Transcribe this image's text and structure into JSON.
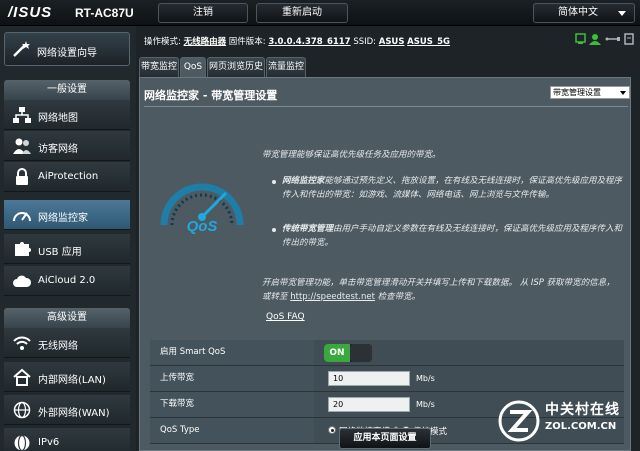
{
  "header": {
    "brand": "/ISUS",
    "model": "RT-AC87U",
    "logout_label": "注销",
    "reboot_label": "重新启动",
    "language": "简体中文"
  },
  "sidebar": {
    "wizard_label": "网络设置向导",
    "general_title": "一般设置",
    "general_items": [
      {
        "label": "网络地图",
        "icon": "network-map-icon"
      },
      {
        "label": "访客网络",
        "icon": "guest-network-icon"
      },
      {
        "label": "AiProtection",
        "icon": "aiprotection-lock-icon"
      },
      {
        "label": "网络监控家",
        "icon": "traffic-gauge-icon"
      },
      {
        "label": "USB 应用",
        "icon": "usb-puzzle-icon"
      },
      {
        "label": "AiCloud 2.0",
        "icon": "cloud-icon"
      }
    ],
    "advanced_title": "高级设置",
    "advanced_items": [
      {
        "label": "无线网络",
        "icon": "wireless-icon"
      },
      {
        "label": "内部网络(LAN)",
        "icon": "home-icon"
      },
      {
        "label": "外部网络(WAN)",
        "icon": "globe-icon"
      },
      {
        "label": "IPv6",
        "icon": "ipv6-globe-icon"
      }
    ]
  },
  "status": {
    "mode_label": "操作模式:",
    "mode_value": "无线路由器",
    "fw_label": "固件版本:",
    "fw_value": "3.0.0.4.378_6117",
    "ssid_label": "SSID:",
    "ssid_1": "ASUS",
    "ssid_2": "ASUS_5G",
    "icons": [
      "client-status-icon",
      "user-status-icon",
      "usb-status-icon",
      "app-status-icon"
    ]
  },
  "tabs": [
    {
      "label": "带宽监控"
    },
    {
      "label": "QoS"
    },
    {
      "label": "网页浏览历史"
    },
    {
      "label": "流量监控"
    }
  ],
  "panel": {
    "title": "网络监控家 - 带宽管理设置",
    "select_value": "带宽管理设置",
    "gauge_text": "QoS",
    "intro": "带宽管理能够保证高优先级任务及应用的带宽。",
    "bullet1_title": "网络监控家",
    "bullet1_body": "能够通过预先定义、拖放设置，在有线及无线连接时，保证高优先级应用及程序传入和传出的带宽：如游戏、流媒体、网络电话、网上浏览与文件传输。",
    "bullet2_title": "传统带宽管理",
    "bullet2_body": "由用户手动自定义参数在有线及无线连接时，保证高优先级应用及程序传入和传出的带宽。",
    "hint_pre": "开启带宽管理功能，单击带宽管理滑动开关并填写上传和下载数据。 从 ISP 获取带宽的信息，或转至",
    "hint_link": "http://speedtest.net",
    "hint_post": "检查带宽。",
    "faq_link": "QoS FAQ"
  },
  "settings": {
    "enable_label": "启用 Smart QoS",
    "toggle_on": "ON",
    "upload_label": "上传带宽",
    "upload_value": "10",
    "upload_unit": "Mb/s",
    "download_label": "下载带宽",
    "download_value": "20",
    "download_unit": "Mb/s",
    "qos_type_label": "QoS Type",
    "qos_option_1": "网络监控家模式",
    "qos_option_2": "传统模式",
    "qos_selected": "网络监控家模式",
    "apply_label": "应用本页面设置"
  },
  "watermark": {
    "cn": "中关村在线",
    "en": "ZOL.COM.CN"
  }
}
